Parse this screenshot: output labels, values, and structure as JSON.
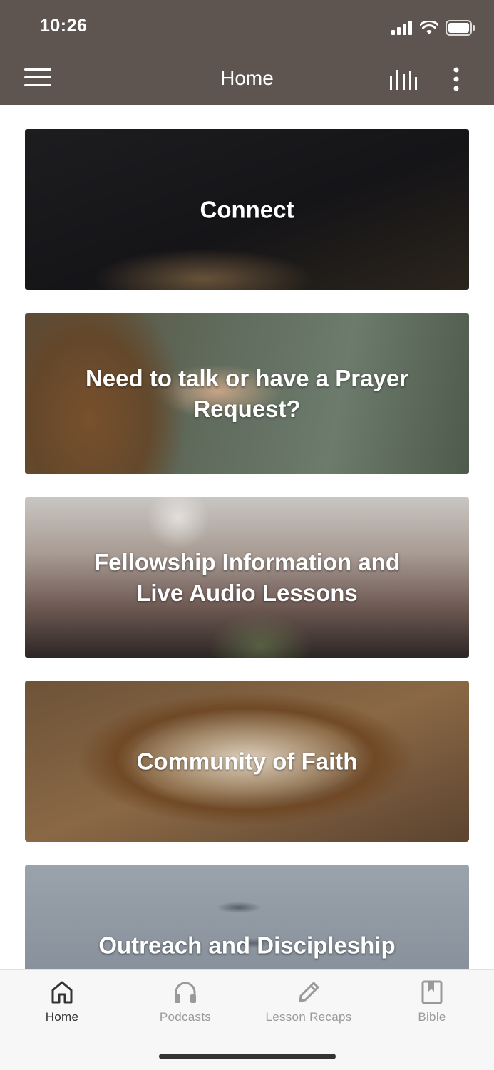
{
  "status_bar": {
    "time": "10:26"
  },
  "header": {
    "title": "Home"
  },
  "cards": [
    {
      "title": "Connect"
    },
    {
      "title": "Need to talk or have a Prayer Request?"
    },
    {
      "title": "Fellowship Information and Live Audio Lessons"
    },
    {
      "title": "Community of Faith"
    },
    {
      "title": "Outreach and Discipleship"
    }
  ],
  "tabs": [
    {
      "label": "Home",
      "icon": "home-icon",
      "active": true
    },
    {
      "label": "Podcasts",
      "icon": "headphones-icon",
      "active": false
    },
    {
      "label": "Lesson Recaps",
      "icon": "pencil-icon",
      "active": false
    },
    {
      "label": "Bible",
      "icon": "bookmark-book-icon",
      "active": false
    }
  ],
  "colors": {
    "header_bg": "#5e5551",
    "tab_active": "#333333",
    "tab_inactive": "#9a9a9a"
  }
}
